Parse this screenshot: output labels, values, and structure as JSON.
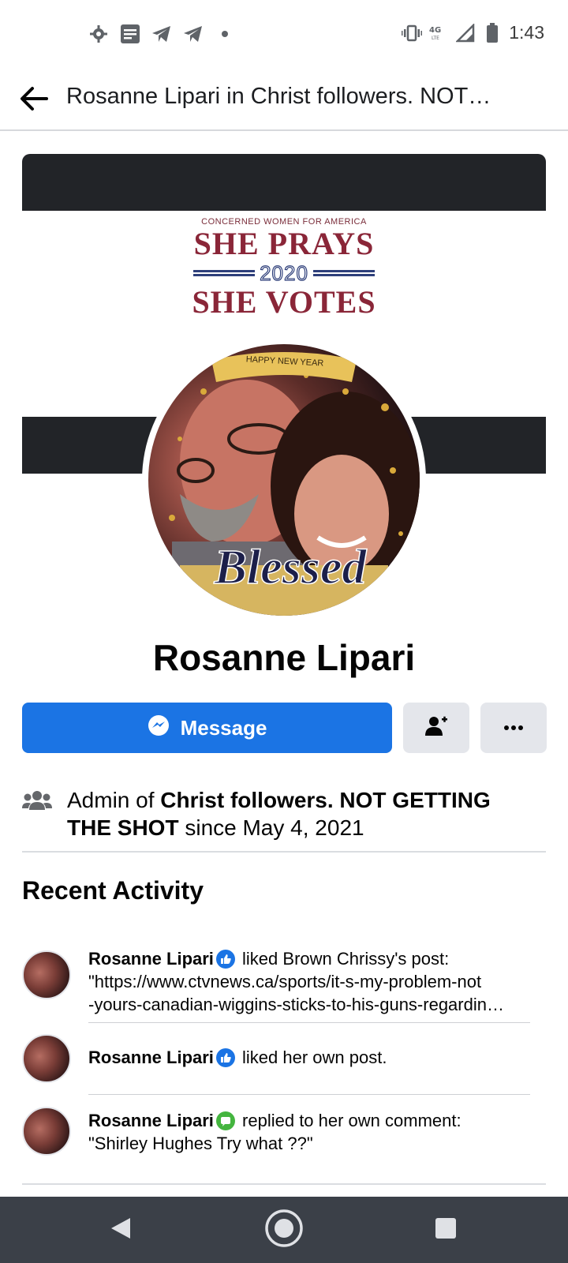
{
  "status_bar": {
    "time": "1:43",
    "left_icons": [
      "gear-icon",
      "message-icon",
      "telegram-icon",
      "telegram-icon",
      "dot-icon"
    ],
    "right_icons": [
      "vibrate-icon",
      "4g-lte-icon",
      "signal-icon",
      "battery-icon"
    ]
  },
  "app_bar": {
    "title": "Rosanne Lipari in Christ followers. NOT…"
  },
  "cover": {
    "banner_small": "CONCERNED WOMEN FOR AMERICA",
    "banner_line1": "SHE PRAYS",
    "banner_year": "2020",
    "banner_line2": "SHE VOTES"
  },
  "avatar": {
    "banner_text": "HAPPY NEW YEAR",
    "script_text": "Blessed"
  },
  "profile": {
    "name": "Rosanne Lipari"
  },
  "actions": {
    "message_label": "Message"
  },
  "admin": {
    "prefix": "Admin of ",
    "group_name": "Christ followers. NOT GETTING THE SHOT",
    "since": " since May 4, 2021"
  },
  "recent_activity": {
    "title": "Recent Activity",
    "items": [
      {
        "name": "Rosanne Lipari",
        "badge": "like",
        "action": " liked Brown Chrissy's post:",
        "line2": "\"https://www.ctvnews.ca/sports/it-s-my-problem-not",
        "line3": "-yours-canadian-wiggins-sticks-to-his-guns-regardin…"
      },
      {
        "name": "Rosanne Lipari",
        "badge": "like",
        "action": " liked her own post.",
        "line2": "",
        "line3": ""
      },
      {
        "name": "Rosanne Lipari",
        "badge": "comment",
        "action": " replied to her own comment:",
        "line2": "\"Shirley Hughes Try what ??\"",
        "line3": ""
      }
    ]
  },
  "colors": {
    "primary": "#1b74e4",
    "secondary_button": "#e4e6eb",
    "nav_bar": "#3b4048",
    "comment_badge": "#44b53f"
  }
}
